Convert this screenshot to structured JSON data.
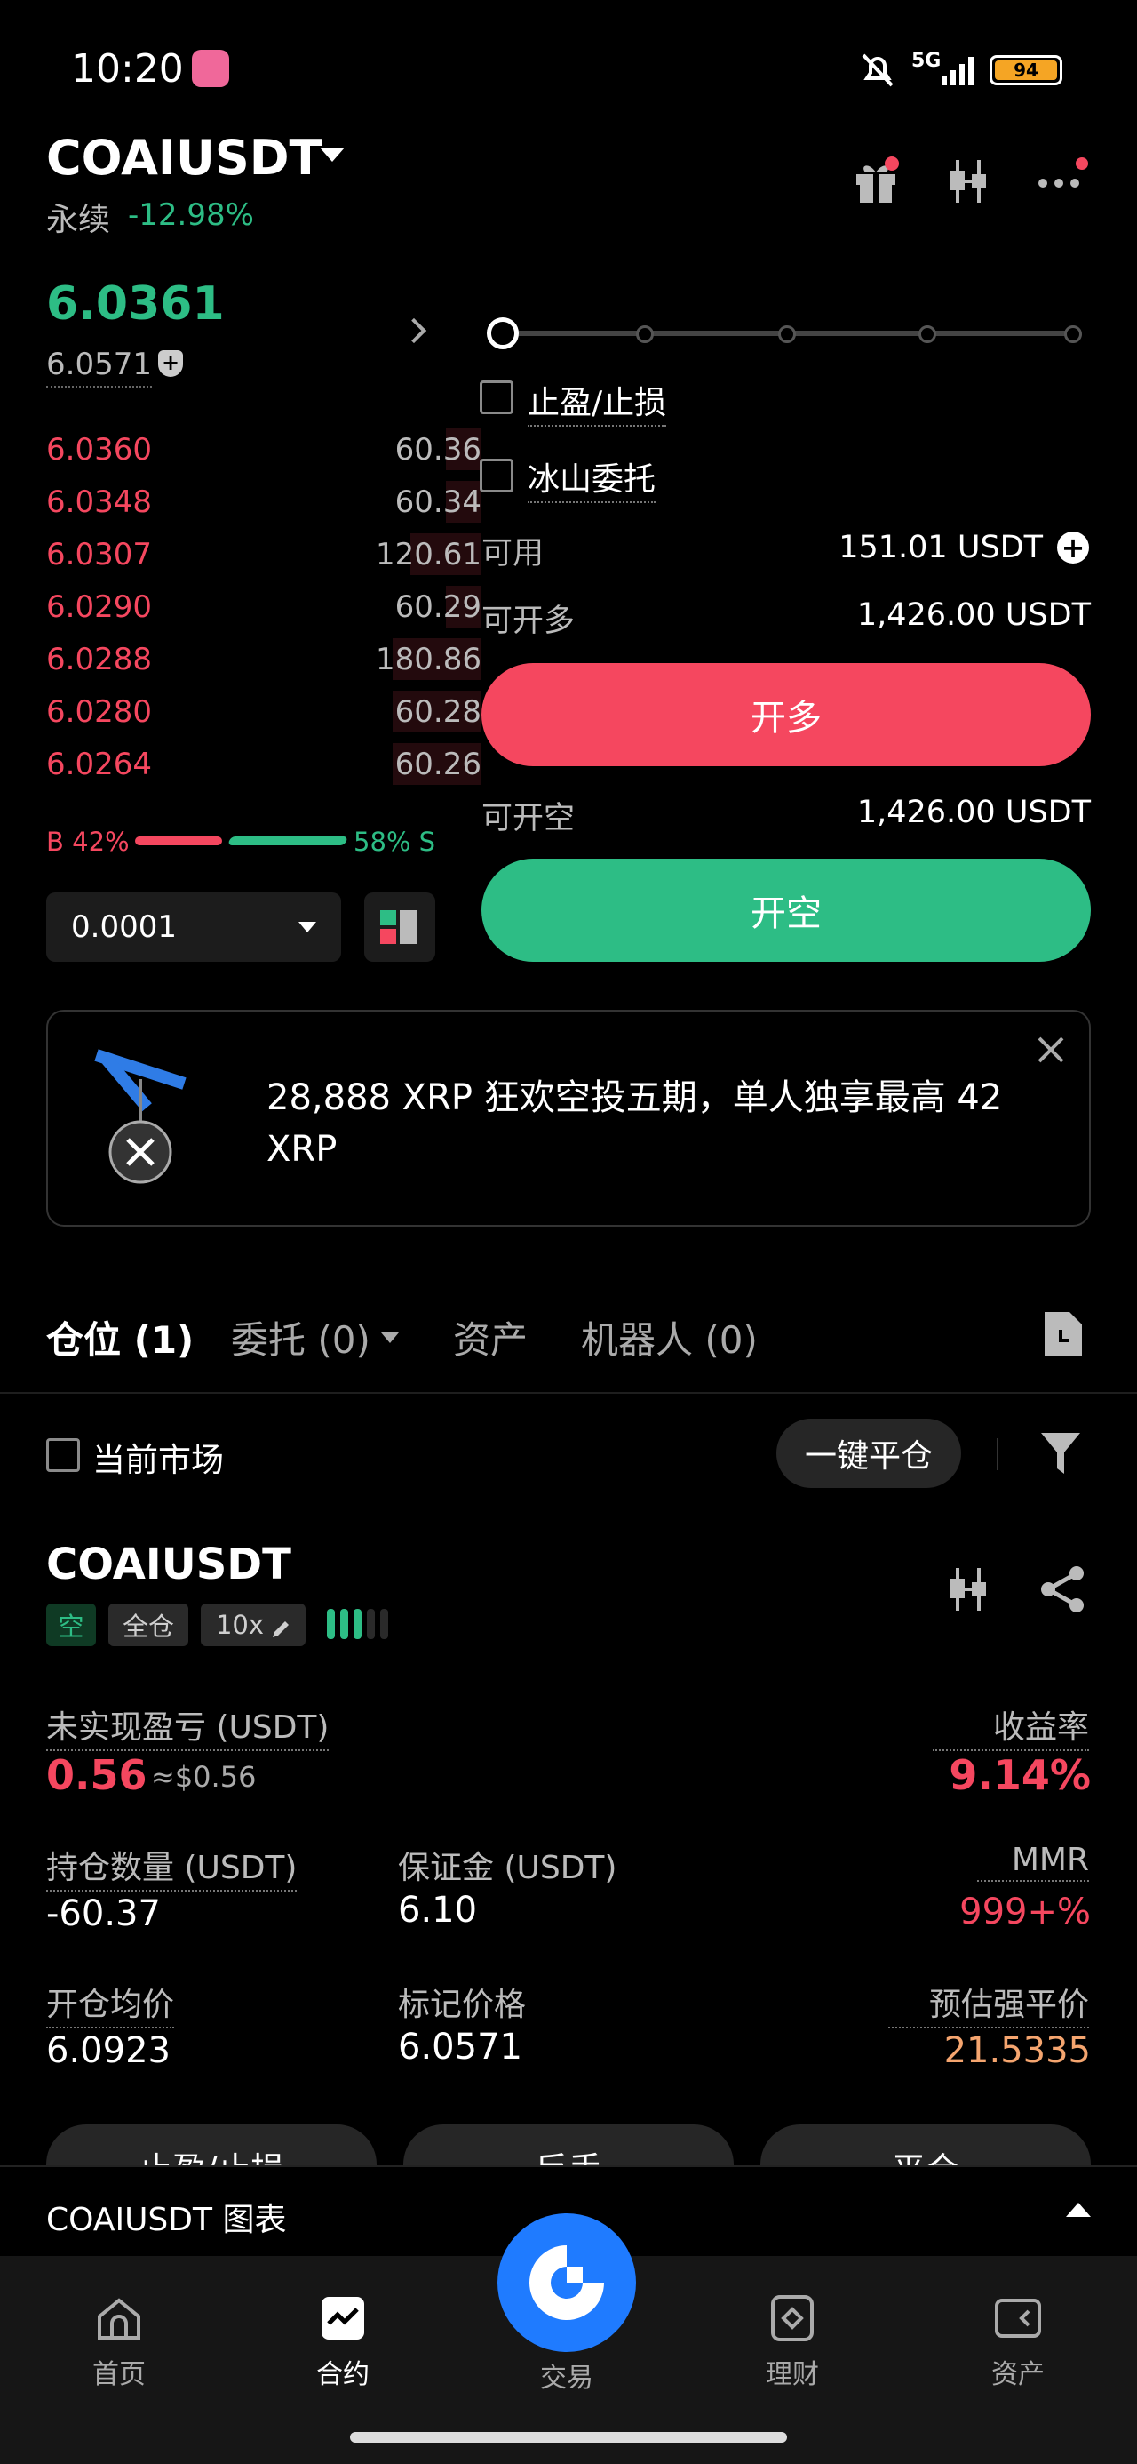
{
  "status_bar": {
    "time": "10:20",
    "network": "5G",
    "battery": "94"
  },
  "header": {
    "symbol": "COAIUSDT",
    "contract_type": "永续",
    "change": "-12.98%"
  },
  "orderbook": {
    "last_price": "6.0361",
    "mark_price": "6.0571",
    "asks": [
      {
        "price": "6.0360",
        "qty": "60.36"
      },
      {
        "price": "6.0348",
        "qty": "60.34"
      },
      {
        "price": "6.0307",
        "qty": "120.61"
      },
      {
        "price": "6.0290",
        "qty": "60.29"
      },
      {
        "price": "6.0288",
        "qty": "180.86"
      },
      {
        "price": "6.0280",
        "qty": "60.28"
      },
      {
        "price": "6.0264",
        "qty": "60.26"
      }
    ],
    "buy_ratio": "B 42%",
    "sell_ratio": "58% S",
    "precision": "0.0001"
  },
  "order_form": {
    "tp_sl_label": "止盈/止损",
    "iceberg_label": "冰山委托",
    "available_label": "可用",
    "available_value": "151.01 USDT",
    "can_long_label": "可开多",
    "can_long_value": "1,426.00 USDT",
    "long_button": "开多",
    "can_short_label": "可开空",
    "can_short_value": "1,426.00 USDT",
    "short_button": "开空"
  },
  "banner": {
    "text": "28,888 XRP 狂欢空投五期，单人独享最高 42 XRP"
  },
  "tabs": [
    {
      "label": "仓位 (1)"
    },
    {
      "label": "委托 (0)"
    },
    {
      "label": "资产"
    },
    {
      "label": "机器人 (0)"
    }
  ],
  "filter": {
    "current_market": "当前市场",
    "close_all": "一键平仓"
  },
  "position": {
    "symbol": "COAIUSDT",
    "side_tag": "空",
    "margin_tag": "全仓",
    "leverage_tag": "10x",
    "unrealized_label": "未实现盈亏 (USDT)",
    "unrealized_value": "0.56",
    "unrealized_approx": "≈$0.56",
    "roe_label": "收益率",
    "roe_value": "9.14%",
    "size_label": "持仓数量 (USDT)",
    "size_value": "-60.37",
    "margin_label": "保证金 (USDT)",
    "margin_value": "6.10",
    "mmr_label": "MMR",
    "mmr_value": "999+%",
    "entry_label": "开仓均价",
    "entry_value": "6.0923",
    "mark_label": "标记价格",
    "mark_value": "6.0571",
    "liq_label": "预估强平价",
    "liq_value": "21.5335",
    "btn_tpsl": "止盈/止损",
    "btn_reverse": "反手",
    "btn_close": "平仓"
  },
  "chart_bar": {
    "label": "COAIUSDT 图表"
  },
  "bottom_nav": [
    {
      "label": "首页"
    },
    {
      "label": "合约"
    },
    {
      "label": "交易"
    },
    {
      "label": "理财"
    },
    {
      "label": "资产"
    }
  ],
  "colors": {
    "red": "#f5475f",
    "green": "#2dbd85",
    "liq": "#f5a56f",
    "brand_blue": "#1f7bff"
  }
}
